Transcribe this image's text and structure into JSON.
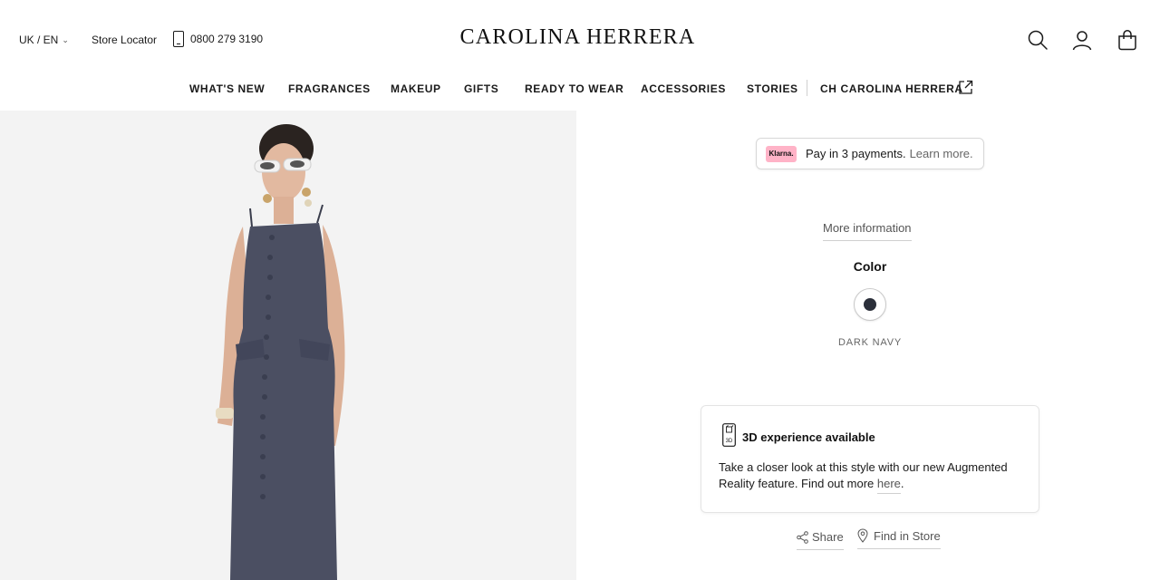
{
  "header": {
    "language_label": "UK / EN",
    "store_locator_label": "Store Locator",
    "phone_number": "0800 279 3190",
    "logo_text": "CAROLINA HERRERA"
  },
  "nav": {
    "items": [
      {
        "label": "WHAT'S NEW"
      },
      {
        "label": "FRAGRANCES"
      },
      {
        "label": "MAKEUP"
      },
      {
        "label": "GIFTS"
      },
      {
        "label": "READY TO WEAR"
      },
      {
        "label": "ACCESSORIES"
      },
      {
        "label": "STORIES"
      },
      {
        "label": "CH CAROLINA HERRERA"
      }
    ]
  },
  "product": {
    "klarna_badge": "Klarna.",
    "klarna_text": "Pay in 3 payments.",
    "klarna_link": "Learn more.",
    "more_information_label": "More information",
    "color_title": "Color",
    "selected_color_name": "DARK NAVY",
    "selected_color_hex": "#2b2f3a",
    "ar": {
      "title": "3D experience available",
      "body": "Take a closer look at this style with our new Augmented Reality feature. Find out more",
      "link": "here",
      "icon_label": "3D"
    },
    "share_label": "Share",
    "find_in_store_label": "Find in Store"
  },
  "icons": {
    "search": "search-icon",
    "account": "account-icon",
    "bag": "shopping-bag-icon",
    "phone": "phone-icon",
    "external": "external-link-icon",
    "share": "share-icon",
    "location": "location-pin-icon"
  },
  "colors": {
    "accent_klarna": "#ffb3c7",
    "dress_denim": "#4b4f62",
    "gallery_bg": "#f3f3f3"
  }
}
